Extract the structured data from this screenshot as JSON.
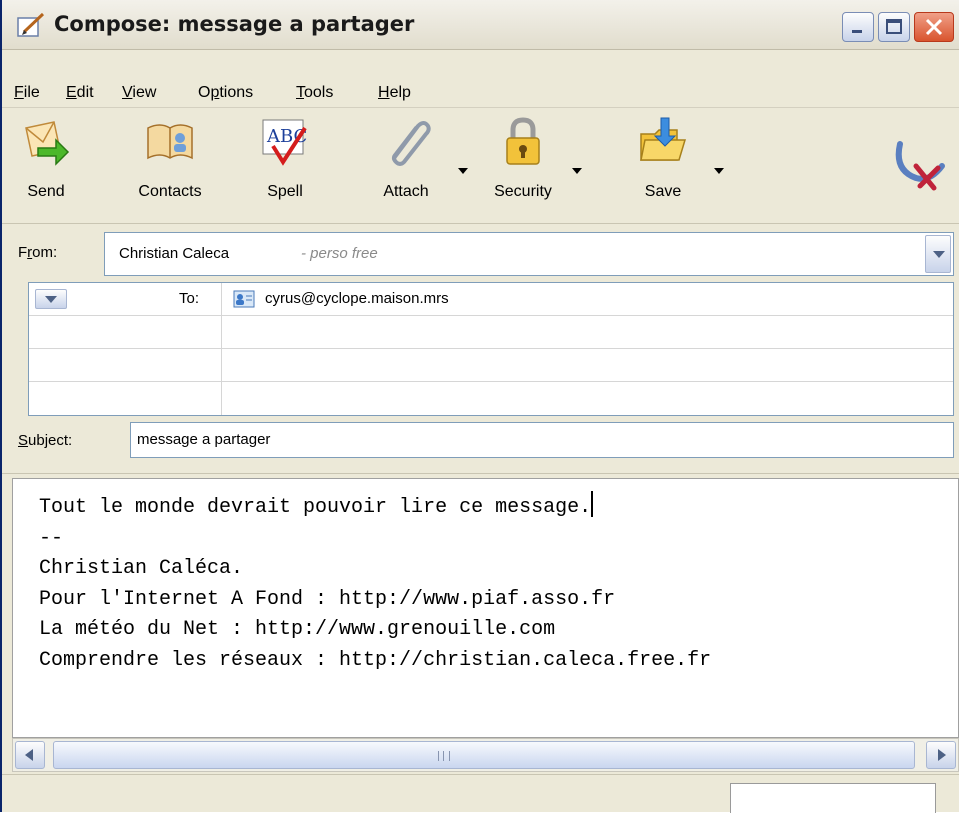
{
  "window": {
    "title": "Compose: message a partager",
    "buttons": [
      "minimize",
      "maximize",
      "close"
    ]
  },
  "menu": {
    "items": [
      {
        "label": "File",
        "mnemonic": "F"
      },
      {
        "label": "Edit",
        "mnemonic": "E"
      },
      {
        "label": "View",
        "mnemonic": "V"
      },
      {
        "label": "Options",
        "mnemonic": "p"
      },
      {
        "label": "Tools",
        "mnemonic": "T"
      },
      {
        "label": "Help",
        "mnemonic": "H"
      }
    ]
  },
  "toolbar": {
    "send": "Send",
    "contacts": "Contacts",
    "spell": "Spell",
    "attach": "Attach",
    "security": "Security",
    "save": "Save",
    "icons": [
      "send-icon",
      "contacts-icon",
      "spell-icon",
      "attach-icon",
      "security-icon",
      "save-icon",
      "throbber-icon"
    ]
  },
  "header": {
    "from_label": "From:",
    "from_name": "Christian Caleca",
    "from_account": "- perso free",
    "to_label": "To:",
    "to_address": "cyrus@cyclope.maison.mrs",
    "subject_label": "Subject:",
    "subject_value": "message a partager"
  },
  "body": {
    "lines": [
      "Tout le monde devrait pouvoir lire ce message.",
      "--",
      "Christian Caléca.",
      "Pour l'Internet A Fond : http://www.piaf.asso.fr",
      "La météo du Net : http://www.grenouille.com",
      "Comprendre les réseaux : http://christian.caleca.free.fr"
    ]
  },
  "colors": {
    "chrome": "#ece9d8",
    "title_border": "#0a246a",
    "close_button": "#d9542e",
    "field_border": "#7f9db9"
  }
}
